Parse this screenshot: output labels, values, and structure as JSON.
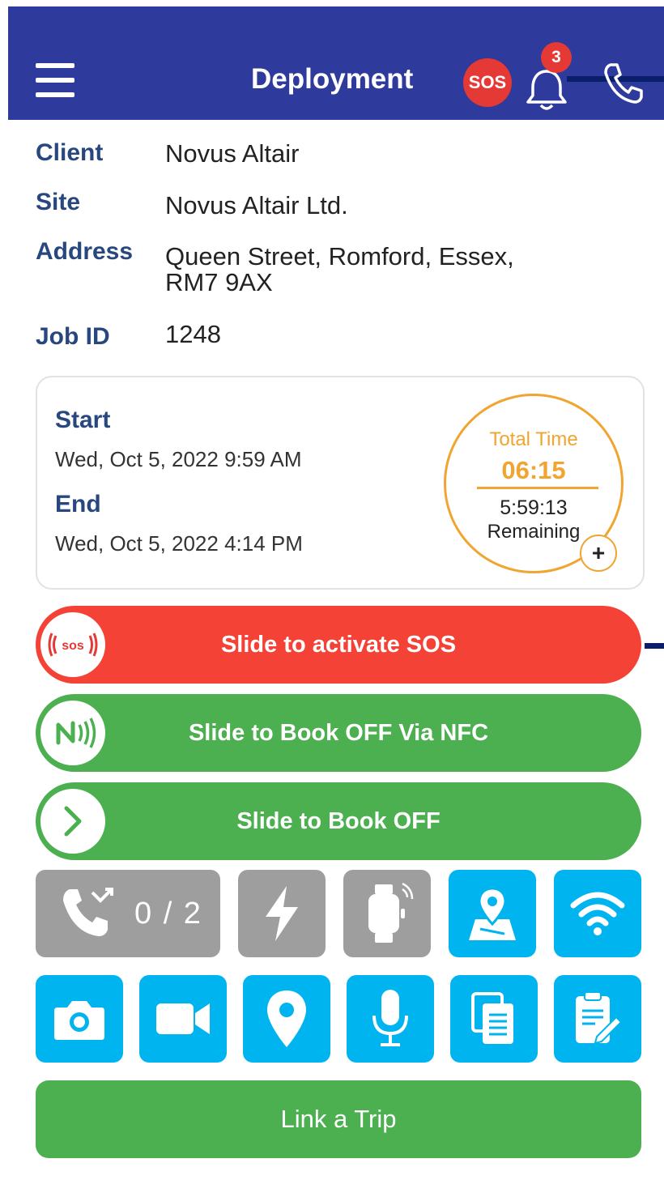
{
  "header": {
    "title": "Deployment",
    "sos_label": "SOS",
    "notification_count": "3",
    "color": "#2e3a9c"
  },
  "info": {
    "client_label": "Client",
    "client_value": "Novus Altair",
    "site_label": "Site",
    "site_value": "Novus Altair Ltd.",
    "address_label": "Address",
    "address_line1": "Queen Street, Romford, Essex,",
    "address_line2": "RM7 9AX",
    "job_label": "Job ID",
    "job_value": "1248"
  },
  "time_card": {
    "start_label": "Start",
    "start_value": "Wed, Oct 5, 2022 9:59 AM",
    "end_label": "End",
    "end_value": "Wed, Oct 5, 2022 4:14 PM",
    "total_label": "Total Time",
    "total_value": "06:15",
    "remaining_value": "5:59:13",
    "remaining_label": "Remaining",
    "plus_label": "+",
    "accent_color": "#f0a531"
  },
  "actions": {
    "sos_slide": "Slide to activate SOS",
    "sos_knob": "sos",
    "nfc_slide": "Slide to Book OFF Via NFC",
    "book_off_slide": "Slide to Book OFF",
    "sos_color": "#f44336",
    "green_color": "#4caf50"
  },
  "tiles": {
    "call_count": "0 / 2",
    "row1_icons": [
      "phone-call-icon",
      "lightning-icon",
      "smartwatch-icon",
      "map-pin-icon",
      "wifi-icon"
    ],
    "row2_icons": [
      "camera-icon",
      "video-icon",
      "location-icon",
      "microphone-icon",
      "documents-icon",
      "clipboard-edit-icon"
    ],
    "gray_color": "#9e9e9e",
    "blue_color": "#00b4ef"
  },
  "link_trip": {
    "label": "Link a Trip"
  }
}
